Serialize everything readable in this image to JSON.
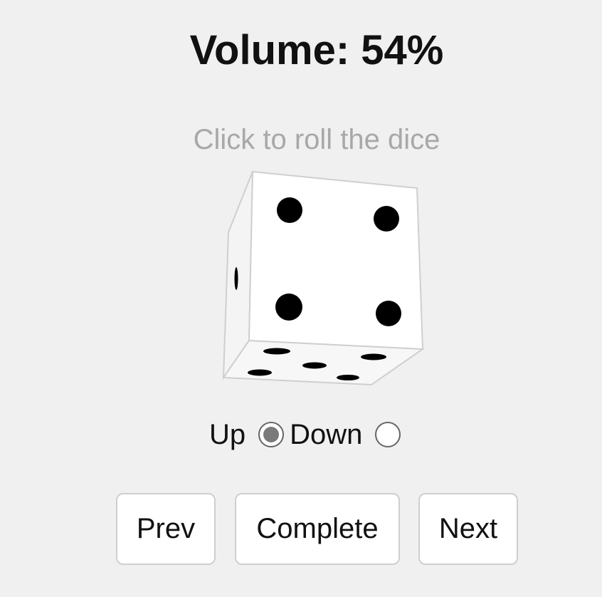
{
  "header": {
    "volume_label": "Volume:",
    "volume_value": "54%"
  },
  "dice": {
    "hint": "Click to roll the dice",
    "front_face_value": 4,
    "bottom_face_value": 5
  },
  "direction": {
    "up_label": "Up",
    "down_label": "Down",
    "selected": "up"
  },
  "buttons": {
    "prev": "Prev",
    "complete": "Complete",
    "next": "Next"
  }
}
